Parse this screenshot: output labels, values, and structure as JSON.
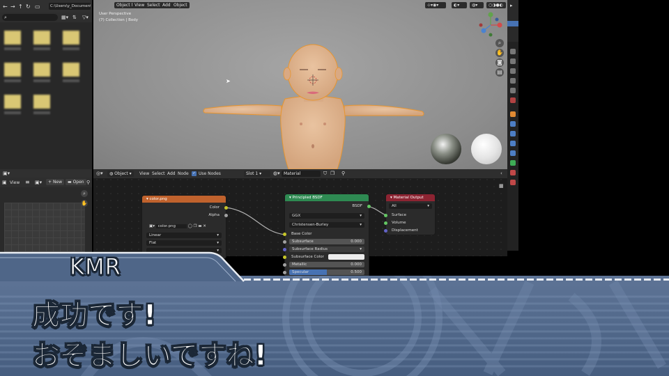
{
  "filebrowser": {
    "path": "C:\\Users\\y_Documents\\"
  },
  "viewport": {
    "mode": "Object Mode",
    "menu": [
      "View",
      "Select",
      "Add",
      "Object"
    ],
    "perspective": "User Perspective",
    "collection": "(7) Collection | Body"
  },
  "image_editor": {
    "view": "View",
    "new": "New",
    "open": "Open"
  },
  "node_editor": {
    "type": "Object",
    "menu": [
      "View",
      "Select",
      "Add",
      "Node"
    ],
    "use_nodes": "Use Nodes",
    "slot": "Slot 1",
    "material": "Material"
  },
  "nodes": {
    "image": {
      "title": "color.png",
      "out_color": "Color",
      "out_alpha": "Alpha",
      "image_name": "color.png",
      "interp": "Linear",
      "projection": "Flat"
    },
    "bsdf": {
      "title": "Principled BSDF",
      "out": "BSDF",
      "distribution": "GGX",
      "sss_method": "Christensen-Burley",
      "base_color": "Base Color",
      "subsurface": "Subsurface",
      "subsurface_val": "0.000",
      "subsurface_radius": "Subsurface Radius",
      "subsurface_color": "Subsurface Color",
      "metallic": "Metallic",
      "metallic_val": "0.000",
      "specular": "Specular",
      "specular_val": "0.500",
      "specular_fraction": 0.5
    },
    "output": {
      "title": "Material Output",
      "target": "All",
      "surface": "Surface",
      "volume": "Volume",
      "displacement": "Displacement"
    }
  },
  "colors": {
    "image_header": "#c0622d",
    "bsdf_header": "#2e8a52",
    "output_header": "#8c2432",
    "socket_yellow": "#c7c729",
    "socket_green": "#63c763",
    "socket_gray": "#a1a1a1",
    "socket_purple": "#6363c7",
    "accent_blue": "#4772b3"
  },
  "subtitle": {
    "speaker": "KMR",
    "line1": "成功です!",
    "line2": "おぞましいですね!"
  }
}
